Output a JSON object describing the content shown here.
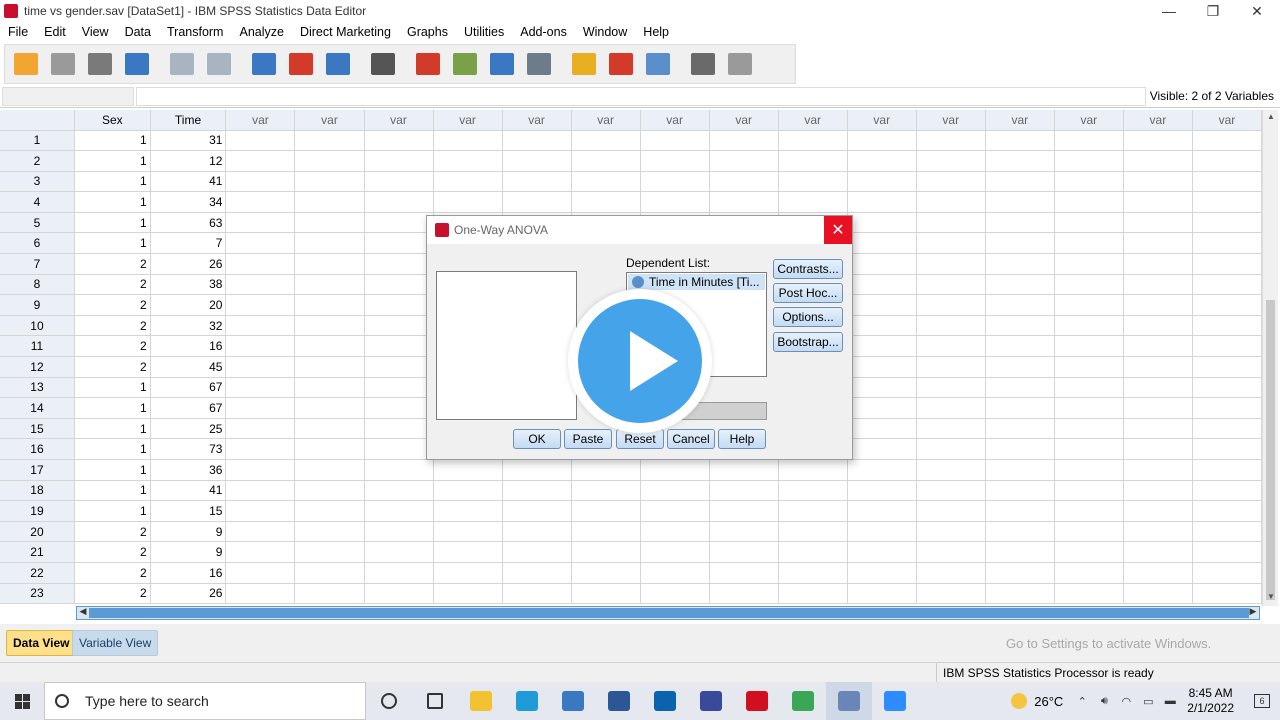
{
  "window": {
    "title": "time vs gender.sav [DataSet1] - IBM SPSS Statistics Data Editor",
    "minimize": "—",
    "restore": "❐",
    "close": "✕"
  },
  "menu": [
    "File",
    "Edit",
    "View",
    "Data",
    "Transform",
    "Analyze",
    "Direct Marketing",
    "Graphs",
    "Utilities",
    "Add-ons",
    "Window",
    "Help"
  ],
  "toolbar_icons": [
    {
      "name": "open-folder-icon",
      "color": "#f2a531"
    },
    {
      "name": "save-icon",
      "color": "#9a9a9a"
    },
    {
      "name": "print-icon",
      "color": "#7a7a7a"
    },
    {
      "name": "dialog-recall-icon",
      "color": "#3b78c2"
    },
    {
      "name": "undo-icon",
      "color": "#a8b4c2"
    },
    {
      "name": "redo-icon",
      "color": "#a8b4c2"
    },
    {
      "name": "goto-case-icon",
      "color": "#3b78c2"
    },
    {
      "name": "goto-variable-icon",
      "color": "#d43a2a"
    },
    {
      "name": "variables-icon",
      "color": "#3b78c2"
    },
    {
      "name": "find-icon",
      "color": "#555555"
    },
    {
      "name": "insert-cases-icon",
      "color": "#d43a2a"
    },
    {
      "name": "insert-variable-icon",
      "color": "#7aa04a"
    },
    {
      "name": "split-file-icon",
      "color": "#3b78c2"
    },
    {
      "name": "weight-cases-icon",
      "color": "#6d7b8a"
    },
    {
      "name": "select-cases-icon",
      "color": "#e8b020"
    },
    {
      "name": "value-labels-icon",
      "color": "#d43a2a"
    },
    {
      "name": "use-sets-icon",
      "color": "#5b8fc9"
    },
    {
      "name": "show-all-variables-icon",
      "color": "#6a6a6a"
    },
    {
      "name": "spell-check-icon",
      "color": "#9a9a9a"
    }
  ],
  "cell_editor": {
    "visible": "Visible: 2 of 2 Variables"
  },
  "grid": {
    "columns": [
      "Sex",
      "Time"
    ],
    "empty_col": "var",
    "empty_count": 15,
    "rows": [
      [
        1,
        31
      ],
      [
        1,
        12
      ],
      [
        1,
        41
      ],
      [
        1,
        34
      ],
      [
        1,
        63
      ],
      [
        1,
        7
      ],
      [
        2,
        26
      ],
      [
        2,
        38
      ],
      [
        2,
        20
      ],
      [
        2,
        32
      ],
      [
        2,
        16
      ],
      [
        2,
        45
      ],
      [
        1,
        67
      ],
      [
        1,
        67
      ],
      [
        1,
        25
      ],
      [
        1,
        73
      ],
      [
        1,
        36
      ],
      [
        1,
        41
      ],
      [
        1,
        15
      ],
      [
        2,
        9
      ],
      [
        2,
        9
      ],
      [
        2,
        16
      ],
      [
        2,
        26
      ]
    ]
  },
  "tabs": {
    "data_view": "Data View",
    "variable_view": "Variable View"
  },
  "activation_text": "Go to Settings to activate Windows.",
  "status": "IBM SPSS Statistics Processor is ready",
  "dialog": {
    "title": "One-Way ANOVA",
    "dependent_label": "Dependent List:",
    "dependent_item": "Time in Minutes [Ti...",
    "buttons_side": [
      "Contrasts...",
      "Post Hoc...",
      "Options...",
      "Bootstrap..."
    ],
    "buttons_bottom": [
      "OK",
      "Paste",
      "Reset",
      "Cancel",
      "Help"
    ]
  },
  "taskbar": {
    "search_placeholder": "Type here to search",
    "apps": [
      {
        "name": "cortana-icon",
        "color": "#333333"
      },
      {
        "name": "task-view-icon",
        "color": "#333333"
      },
      {
        "name": "file-explorer-icon",
        "color": "#f2c230"
      },
      {
        "name": "edge-icon",
        "color": "#1f9bd8"
      },
      {
        "name": "store-icon",
        "color": "#3b78c2"
      },
      {
        "name": "word-icon",
        "color": "#2b5797"
      },
      {
        "name": "outlook-icon",
        "color": "#0a64ad"
      },
      {
        "name": "photo-app-icon",
        "color": "#3a4a9a"
      },
      {
        "name": "opera-icon",
        "color": "#d01020"
      },
      {
        "name": "chrome-icon",
        "color": "#3aa757"
      },
      {
        "name": "spss-icon",
        "color": "#6a86b8"
      },
      {
        "name": "zoom-icon",
        "color": "#2d8cff"
      }
    ],
    "temperature": "26°C",
    "time": "8:45 AM",
    "date": "2/1/2022",
    "notifications": "6"
  }
}
